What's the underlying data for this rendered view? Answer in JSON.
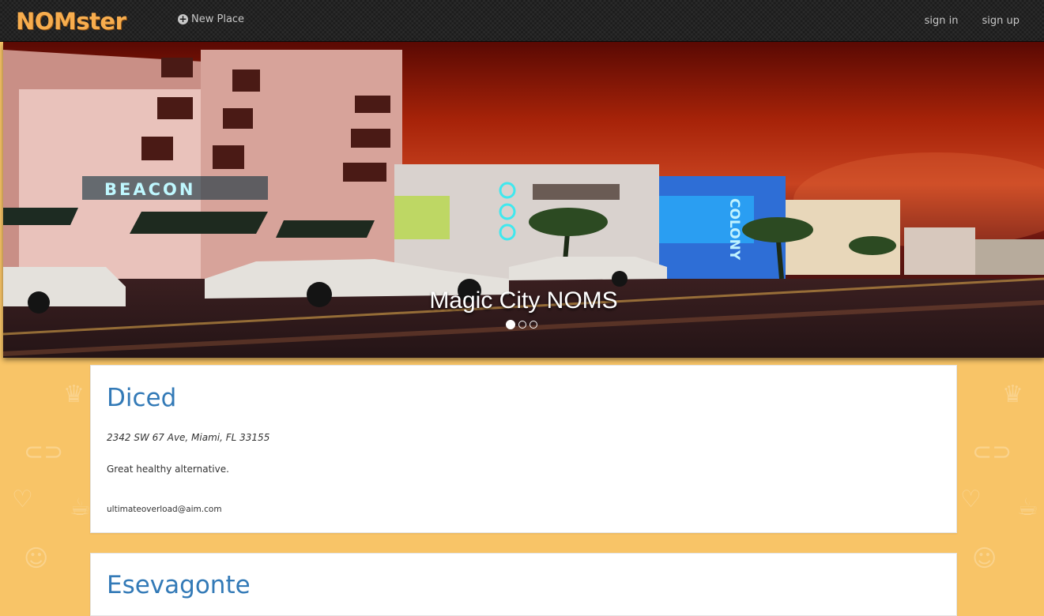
{
  "navbar": {
    "brand": "NOMster",
    "new_place": "New Place",
    "sign_in": "sign in",
    "sign_up": "sign up"
  },
  "carousel": {
    "caption": "Magic City NOMS",
    "slide_count": 3,
    "active_slide": 1,
    "sign_beacon": "BEACON",
    "sign_colony": "COLONY"
  },
  "places": [
    {
      "name": "Diced",
      "address": "2342 SW 67 Ave, Miami, FL 33155",
      "description": "Great healthy alternative.",
      "email": "ultimateoverload@aim.com"
    },
    {
      "name": "Esevagonte"
    }
  ],
  "colors": {
    "brand": "#f7ad4e",
    "navbar": "#1b1b1b",
    "background": "#f8c467",
    "link": "#337ab7"
  }
}
